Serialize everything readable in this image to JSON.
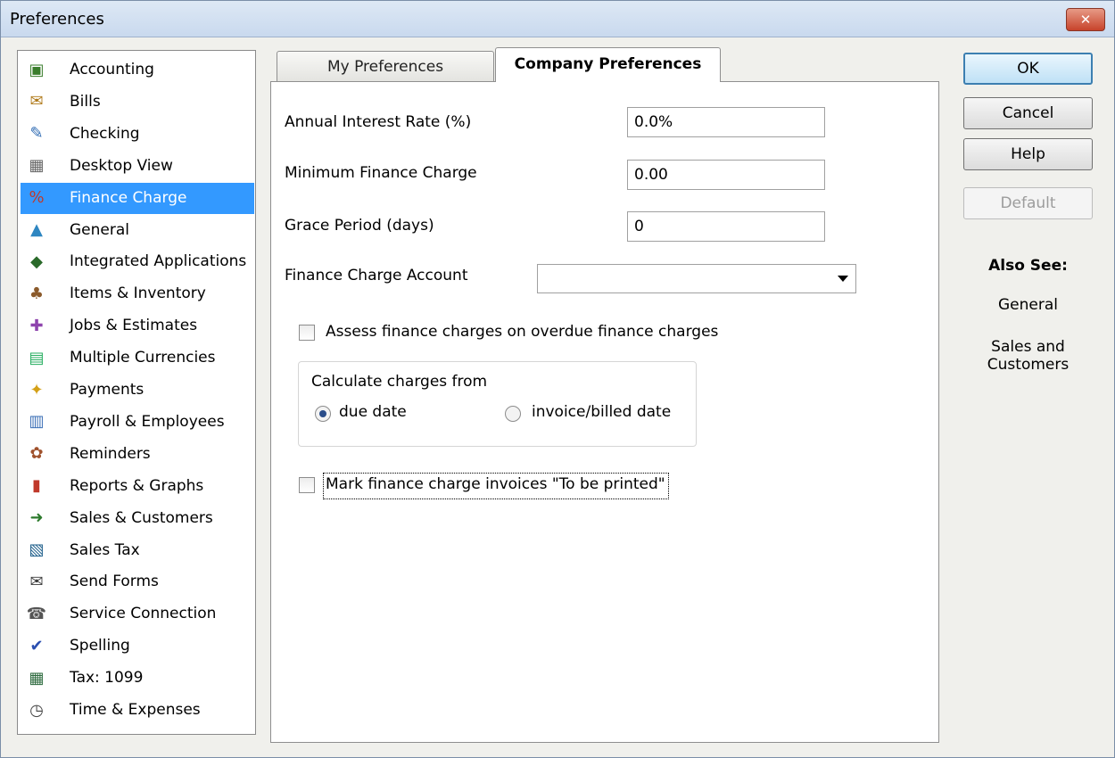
{
  "window": {
    "title": "Preferences",
    "close_glyph": "✕"
  },
  "categories": [
    {
      "label": "Accounting",
      "icon": "accounting-icon",
      "selected": false
    },
    {
      "label": "Bills",
      "icon": "bills-icon",
      "selected": false
    },
    {
      "label": "Checking",
      "icon": "checking-icon",
      "selected": false
    },
    {
      "label": "Desktop View",
      "icon": "desktop-view-icon",
      "selected": false
    },
    {
      "label": "Finance Charge",
      "icon": "finance-charge-icon",
      "selected": true
    },
    {
      "label": "General",
      "icon": "general-icon",
      "selected": false
    },
    {
      "label": "Integrated Applications",
      "icon": "integrated-applications-icon",
      "selected": false
    },
    {
      "label": "Items & Inventory",
      "icon": "items-inventory-icon",
      "selected": false
    },
    {
      "label": "Jobs & Estimates",
      "icon": "jobs-estimates-icon",
      "selected": false
    },
    {
      "label": "Multiple Currencies",
      "icon": "multiple-currencies-icon",
      "selected": false
    },
    {
      "label": "Payments",
      "icon": "payments-icon",
      "selected": false
    },
    {
      "label": "Payroll & Employees",
      "icon": "payroll-employees-icon",
      "selected": false
    },
    {
      "label": "Reminders",
      "icon": "reminders-icon",
      "selected": false
    },
    {
      "label": "Reports & Graphs",
      "icon": "reports-graphs-icon",
      "selected": false
    },
    {
      "label": "Sales & Customers",
      "icon": "sales-customers-icon",
      "selected": false
    },
    {
      "label": "Sales Tax",
      "icon": "sales-tax-icon",
      "selected": false
    },
    {
      "label": "Send Forms",
      "icon": "send-forms-icon",
      "selected": false
    },
    {
      "label": "Service Connection",
      "icon": "service-connection-icon",
      "selected": false
    },
    {
      "label": "Spelling",
      "icon": "spelling-icon",
      "selected": false
    },
    {
      "label": "Tax: 1099",
      "icon": "tax-1099-icon",
      "selected": false
    },
    {
      "label": "Time & Expenses",
      "icon": "time-expenses-icon",
      "selected": false
    }
  ],
  "tabs": {
    "my": "My Preferences",
    "company": "Company Preferences",
    "active": "company"
  },
  "form": {
    "interest_label": "Annual Interest Rate (%)",
    "interest_value": "0.0%",
    "min_charge_label": "Minimum Finance Charge",
    "min_charge_value": "0.00",
    "grace_label": "Grace Period (days)",
    "grace_value": "0",
    "account_label": "Finance Charge Account",
    "account_value": "",
    "assess_label": "Assess finance charges on overdue finance charges",
    "assess_checked": false,
    "calc_group_label": "Calculate charges from",
    "radio_due_label": "due date",
    "radio_invoice_label": "invoice/billed date",
    "calc_selected": "due date",
    "mark_label": "Mark finance charge invoices \"To be printed\"",
    "mark_checked": false
  },
  "buttons": {
    "ok": "OK",
    "cancel": "Cancel",
    "help": "Help",
    "default": "Default"
  },
  "also_see": {
    "heading": "Also See:",
    "links": [
      "General",
      "Sales and Customers"
    ]
  },
  "colors": {
    "selection": "#3399ff",
    "dialog_bg": "#f0f0ec",
    "close_button": "#c7432b"
  }
}
